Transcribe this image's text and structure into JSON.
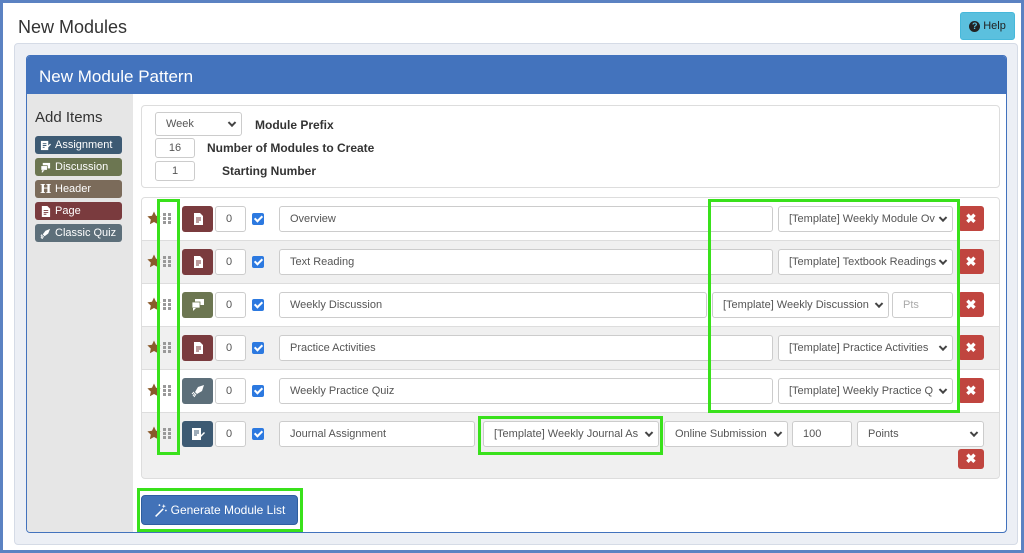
{
  "page": {
    "title": "New Modules",
    "help_label": "Help"
  },
  "panel": {
    "title": "New Module Pattern"
  },
  "sidebar": {
    "title": "Add Items",
    "items": [
      {
        "label": "Assignment",
        "icon": "assignment-icon",
        "color": "#3d5a73"
      },
      {
        "label": "Discussion",
        "icon": "discussion-icon",
        "color": "#6c7651"
      },
      {
        "label": "Header",
        "icon": "header-icon",
        "color": "#7b6b5a"
      },
      {
        "label": "Page",
        "icon": "page-icon",
        "color": "#7a3b3e"
      },
      {
        "label": "Classic Quiz",
        "icon": "quiz-icon",
        "color": "#5d6f7a"
      }
    ]
  },
  "settings": {
    "prefix_value": "Week",
    "prefix_label": "Module Prefix",
    "count_value": "16",
    "count_label": "Number of Modules to Create",
    "start_value": "1",
    "start_label": "Starting Number"
  },
  "rows": [
    {
      "type": "page",
      "indent": "0",
      "checked": true,
      "title": "Overview",
      "template": "[Template] Weekly Module Ov"
    },
    {
      "type": "page",
      "indent": "0",
      "checked": true,
      "title": "Text Reading",
      "template": "[Template] Textbook Readings"
    },
    {
      "type": "discussion",
      "indent": "0",
      "checked": true,
      "title": "Weekly Discussion",
      "template": "[Template] Weekly Discussion",
      "points_placeholder": "Pts"
    },
    {
      "type": "page",
      "indent": "0",
      "checked": true,
      "title": "Practice Activities",
      "template": "[Template] Practice Activities"
    },
    {
      "type": "quiz",
      "indent": "0",
      "checked": true,
      "title": "Weekly Practice Quiz",
      "template": "[Template] Weekly Practice Q"
    },
    {
      "type": "assignment",
      "indent": "0",
      "checked": true,
      "title": "Journal Assignment",
      "template": "[Template] Weekly Journal As",
      "submission": "Online Submission",
      "points": "100",
      "grading": "Points"
    }
  ],
  "colors": {
    "page": "#7a3b3e",
    "discussion": "#6c7651",
    "quiz": "#5d6f7a",
    "assignment": "#3d5a73",
    "highlight": "#39e11b",
    "delete": "#c0453f",
    "primary": "#4373bd"
  },
  "generate_label": "Generate Module List",
  "delete_glyph": "✖"
}
